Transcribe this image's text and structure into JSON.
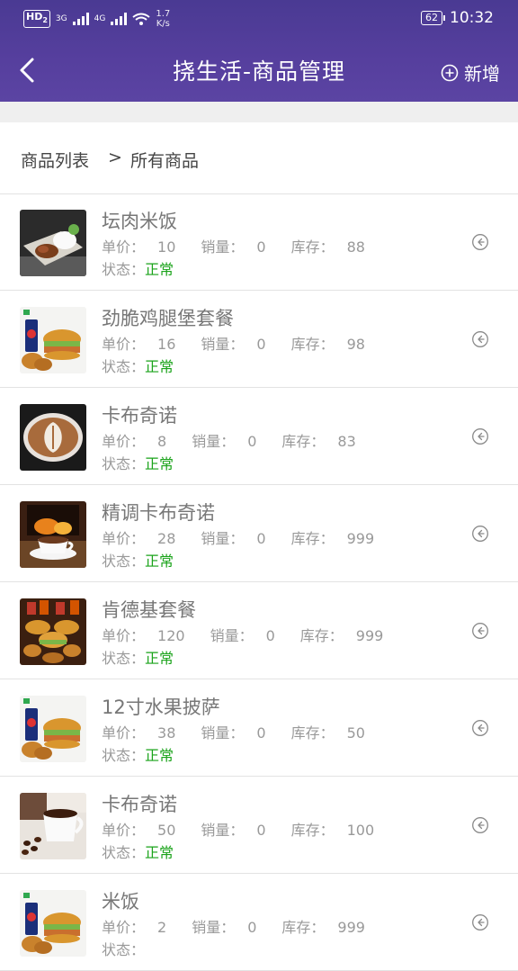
{
  "status_bar": {
    "hd": "HD",
    "hd_sub": "2",
    "net1": "3G",
    "net2": "4G",
    "speed_value": "1.7",
    "speed_unit": "K/s",
    "battery": "62",
    "time": "10:32"
  },
  "header": {
    "title": "挠生活-商品管理",
    "add_label": "新增",
    "back_icon": "chevron-left-icon",
    "add_icon": "plus-circle-icon"
  },
  "breadcrumb": {
    "parent": "商品列表",
    "separator": ">",
    "current": "所有商品"
  },
  "labels": {
    "price": "单价：",
    "sales": "销量：",
    "stock": "库存：",
    "status": "状态："
  },
  "colors": {
    "header": "#543e9c",
    "status_normal": "#1aa31a"
  },
  "products": [
    {
      "name": "坛肉米饭",
      "price": "10",
      "sales": "0",
      "stock": "88",
      "status": "正常",
      "image": "braised-pork-rice"
    },
    {
      "name": "劲脆鸡腿堡套餐",
      "price": "16",
      "sales": "0",
      "stock": "98",
      "status": "正常",
      "image": "burger-combo"
    },
    {
      "name": "卡布奇诺",
      "price": "8",
      "sales": "0",
      "stock": "83",
      "status": "正常",
      "image": "cappuccino-latte-art"
    },
    {
      "name": "精调卡布奇诺",
      "price": "28",
      "sales": "0",
      "stock": "999",
      "status": "正常",
      "image": "coffee-by-fireplace"
    },
    {
      "name": "肯德基套餐",
      "price": "120",
      "sales": "0",
      "stock": "999",
      "status": "正常",
      "image": "kfc-meal-spread"
    },
    {
      "name": "12寸水果披萨",
      "price": "38",
      "sales": "0",
      "stock": "50",
      "status": "正常",
      "image": "burger-combo"
    },
    {
      "name": "卡布奇诺",
      "price": "50",
      "sales": "0",
      "stock": "100",
      "status": "正常",
      "image": "coffee-cup-beans"
    },
    {
      "name": "米饭",
      "price": "2",
      "sales": "0",
      "stock": "999",
      "status": "",
      "image": "burger-combo"
    }
  ]
}
